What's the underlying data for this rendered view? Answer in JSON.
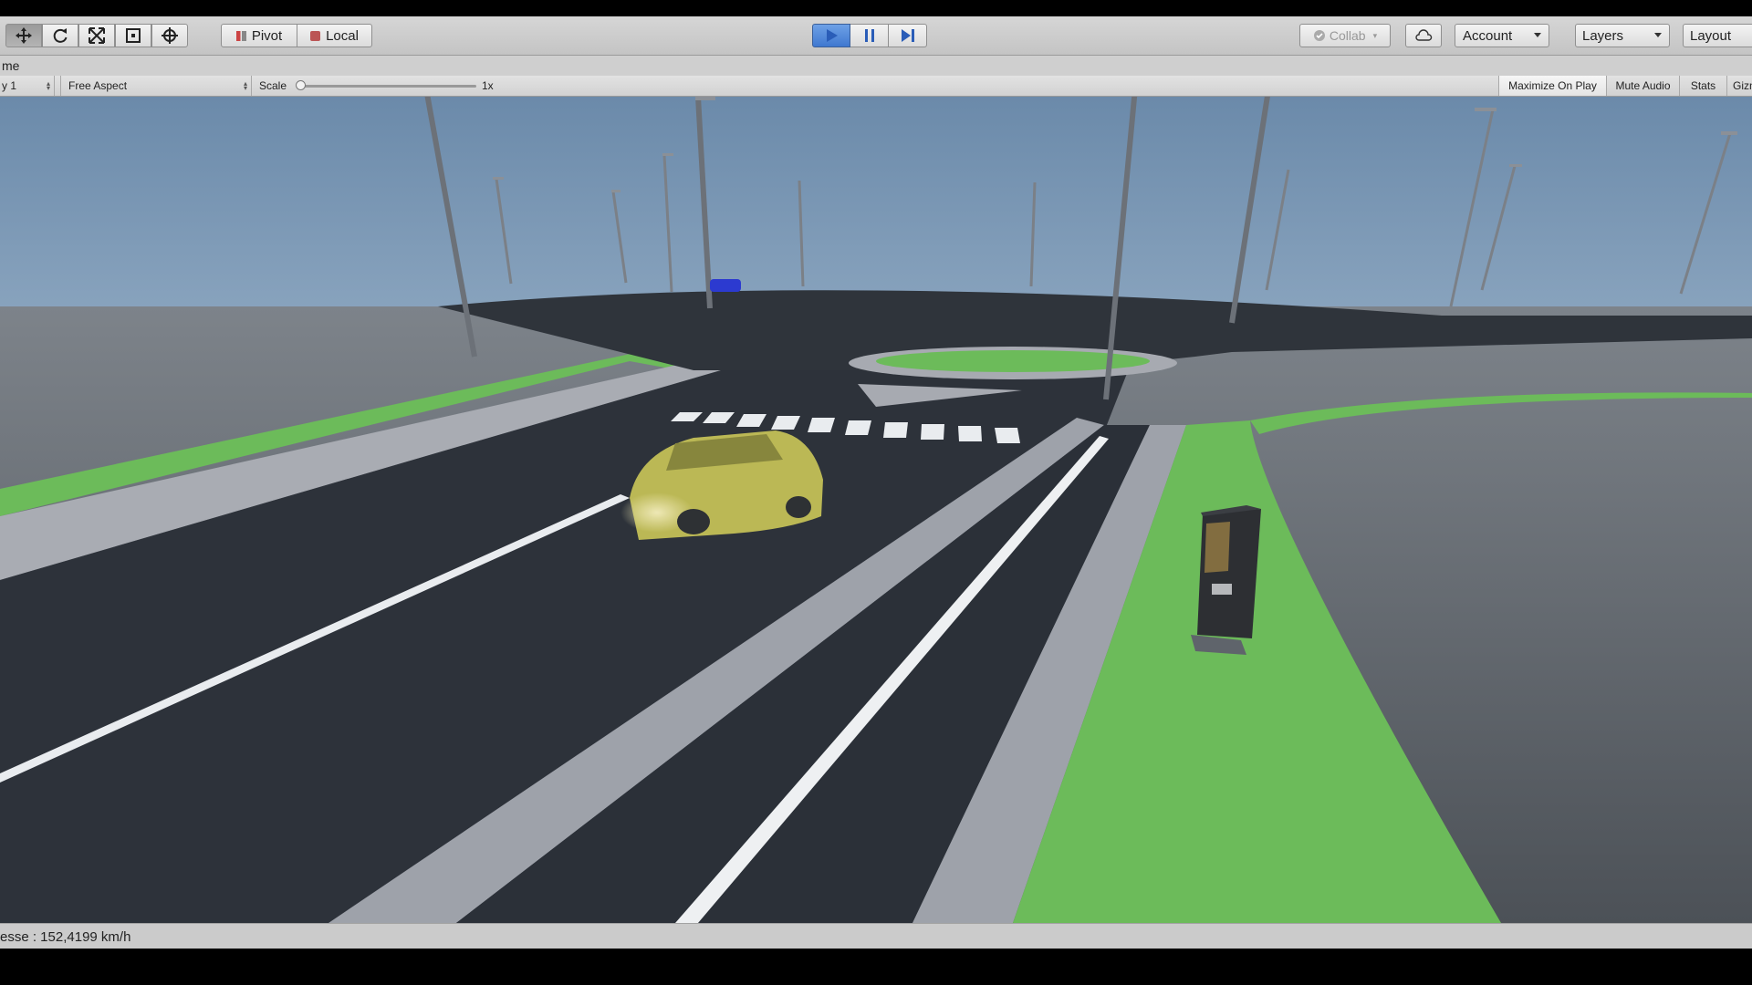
{
  "toolbar": {
    "tools": [
      "move-tool",
      "rotate-tool",
      "scale-tool",
      "rect-tool",
      "transform-tool"
    ],
    "pivot_label": "Pivot",
    "local_label": "Local",
    "collab_label": "Collab",
    "account_label": "Account",
    "layers_label": "Layers",
    "layout_label": "Layout",
    "accent_color": "#3f78d0"
  },
  "game_tab": {
    "title": "me"
  },
  "game_bar": {
    "display": "y 1",
    "aspect": "Free Aspect",
    "scale_label": "Scale",
    "scale_value": "1x",
    "maximize_label": "Maximize On Play",
    "mute_label": "Mute Audio",
    "stats_label": "Stats",
    "gizmos_label": "Gizm"
  },
  "status": {
    "speed_text": "esse : 152,4199 km/h"
  }
}
